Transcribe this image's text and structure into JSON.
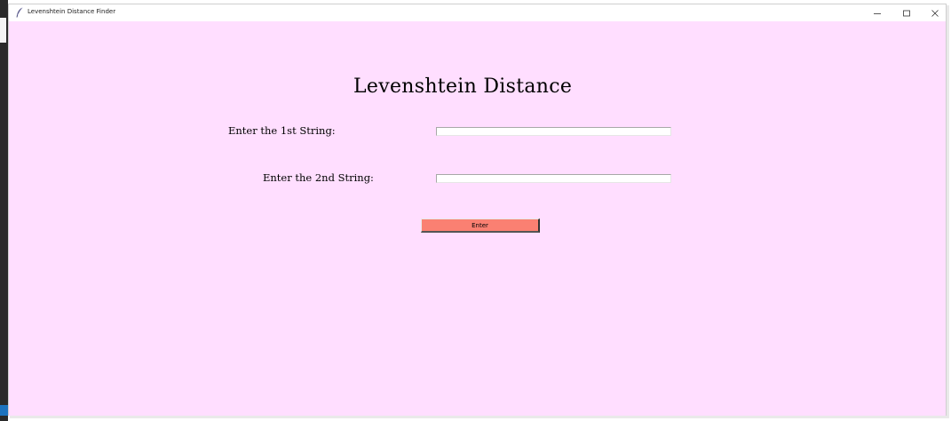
{
  "window": {
    "title": "Levenshtein Distance Finder",
    "app_icon": "feather-icon",
    "controls": {
      "minimize_icon": "minimize-icon",
      "maximize_icon": "maximize-icon",
      "close_icon": "close-icon"
    }
  },
  "form": {
    "heading": "Levenshtein Distance",
    "string1_label": "Enter the 1st String:",
    "string1_value": "",
    "string2_label": "Enter the 2nd String:",
    "string2_value": "",
    "submit_label": "Enter"
  },
  "colors": {
    "background": "#ffdeff",
    "button": "#fa8072"
  }
}
